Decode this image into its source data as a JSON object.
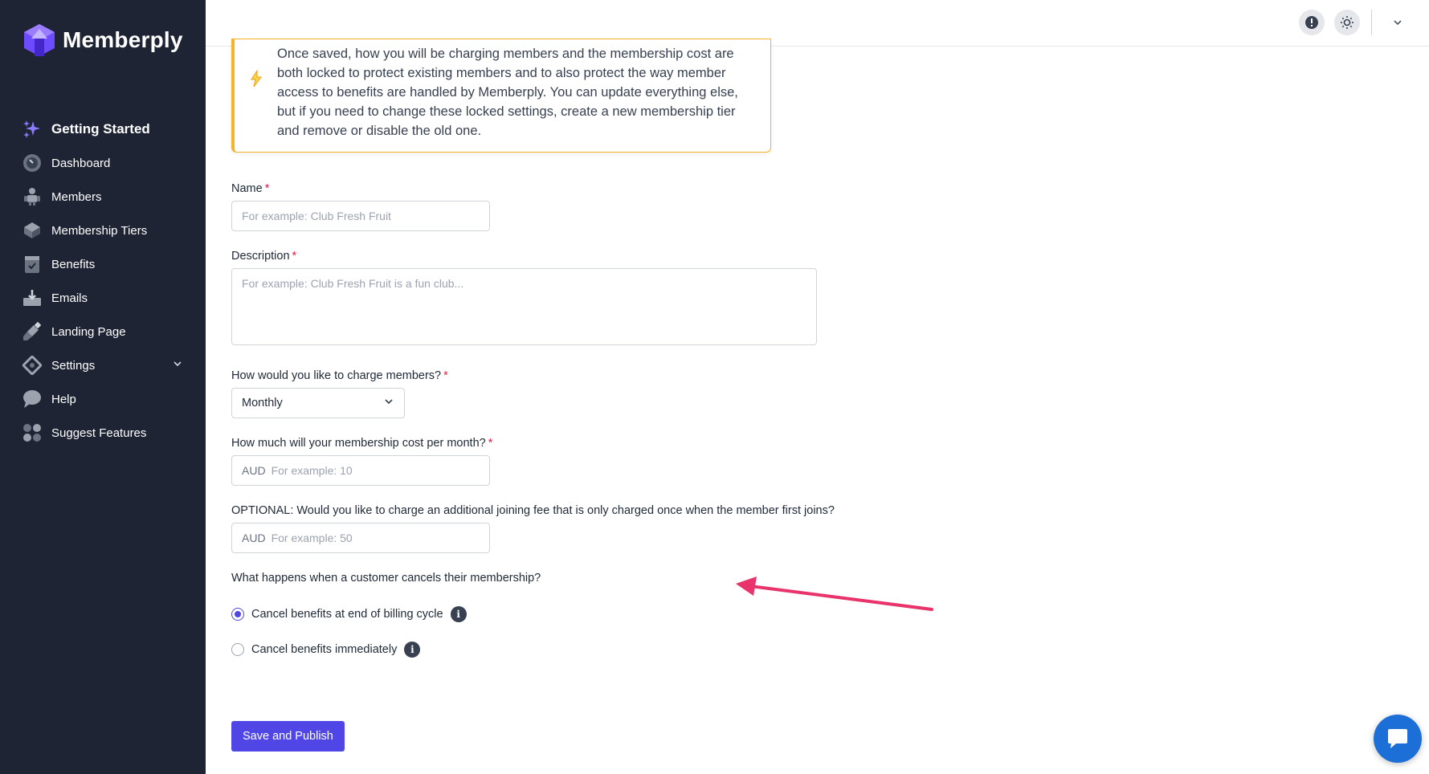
{
  "brand": {
    "name": "Memberply",
    "logo_color": "#7c5cff"
  },
  "sidebar": {
    "items": [
      {
        "label": "Getting Started",
        "icon": "sparkles-icon"
      },
      {
        "label": "Dashboard",
        "icon": "gauge-icon"
      },
      {
        "label": "Members",
        "icon": "users-icon"
      },
      {
        "label": "Membership Tiers",
        "icon": "layers-icon"
      },
      {
        "label": "Benefits",
        "icon": "clipboard-check-icon"
      },
      {
        "label": "Emails",
        "icon": "inbox-icon"
      },
      {
        "label": "Landing Page",
        "icon": "brush-icon"
      },
      {
        "label": "Settings",
        "icon": "settings-icon"
      },
      {
        "label": "Help",
        "icon": "chat-bubble-icon"
      },
      {
        "label": "Suggest Features",
        "icon": "grid-dots-icon"
      }
    ]
  },
  "topbar": {
    "icons": [
      "alert-icon",
      "sun-icon",
      "chevron-down-icon"
    ]
  },
  "notice": {
    "text": "Once saved, how you will be charging members and the membership cost are both locked to protect existing members and to also protect the way member access to benefits are handled by Memberply. You can update everything else, but if you need to change these locked settings, create a new membership tier and remove or disable the old one.",
    "accent": "#f5b32a"
  },
  "form": {
    "name": {
      "label": "Name",
      "required": "*",
      "placeholder": "For example: Club Fresh Fruit"
    },
    "description": {
      "label": "Description",
      "required": "*",
      "placeholder": "For example: Club Fresh Fruit is a fun club..."
    },
    "charge": {
      "label": "How would you like to charge members?",
      "required": "*",
      "value": "Monthly"
    },
    "cost": {
      "label": "How much will your membership cost per month?",
      "required": "*",
      "prefix": "AUD",
      "placeholder": "For example: 10"
    },
    "joining_fee": {
      "label": "OPTIONAL: Would you like to charge an additional joining fee that is only charged once when the member first joins?",
      "prefix": "AUD",
      "placeholder": "For example: 50"
    },
    "cancel": {
      "label": "What happens when a customer cancels their membership?",
      "options": [
        {
          "label": "Cancel benefits at end of billing cycle",
          "checked": true
        },
        {
          "label": "Cancel benefits immediately",
          "checked": false
        }
      ]
    },
    "submit_label": "Save and Publish"
  },
  "colors": {
    "primary": "#4f46e5",
    "sidebar": "#1e2433",
    "required": "#e11d48",
    "annotation_arrow": "#e8336b"
  }
}
